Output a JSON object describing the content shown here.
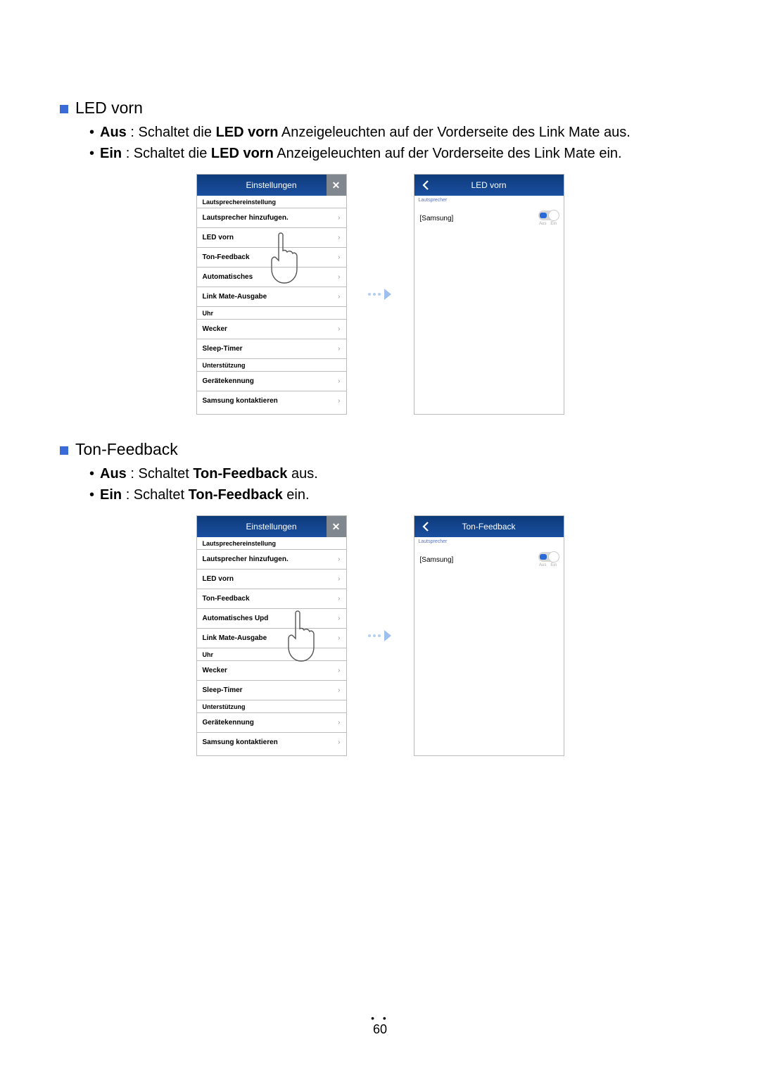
{
  "page_number": "60",
  "section1": {
    "title": "LED vorn",
    "bullets": [
      {
        "bold1": "Aus",
        "mid": " : Schaltet die ",
        "bold2": "LED vorn",
        "rest": " Anzeigeleuchten auf der Vorderseite des Link Mate aus."
      },
      {
        "bold1": "Ein",
        "mid": " : Schaltet die ",
        "bold2": "LED vorn",
        "rest": " Anzeigeleuchten auf der Vorderseite des Link Mate ein."
      }
    ],
    "left_phone": {
      "title": "Einstellungen",
      "groups": [
        {
          "label": "Lautsprechereinstellung",
          "items": [
            "Lautsprecher hinzufugen.",
            "LED vorn",
            "Ton-Feedback",
            "Automatisches",
            "Link Mate-Ausgabe"
          ]
        },
        {
          "label": "Uhr",
          "items": [
            "Wecker",
            "Sleep-Timer"
          ]
        },
        {
          "label": "Unterstützung",
          "items": [
            "Gerätekennung",
            "Samsung kontaktieren"
          ]
        }
      ]
    },
    "right_phone": {
      "title": "LED vorn",
      "section": "Lautsprecher",
      "row": "[Samsung]",
      "toggle": {
        "off": "Aus",
        "on": "Ein",
        "state": "on_right"
      }
    }
  },
  "section2": {
    "title": "Ton-Feedback",
    "bullets": [
      {
        "bold1": "Aus",
        "mid": " : Schaltet ",
        "bold2": "Ton-Feedback",
        "rest": " aus."
      },
      {
        "bold1": "Ein",
        "mid": " : Schaltet ",
        "bold2": "Ton-Feedback",
        "rest": " ein."
      }
    ],
    "left_phone": {
      "title": "Einstellungen",
      "groups": [
        {
          "label": "Lautsprechereinstellung",
          "items": [
            "Lautsprecher hinzufugen.",
            "LED vorn",
            "Ton-Feedback",
            "Automatisches Upd",
            "Link Mate-Ausgabe"
          ]
        },
        {
          "label": "Uhr",
          "items": [
            "Wecker",
            "Sleep-Timer"
          ]
        },
        {
          "label": "Unterstützung",
          "items": [
            "Gerätekennung",
            "Samsung kontaktieren"
          ]
        }
      ]
    },
    "right_phone": {
      "title": "Ton-Feedback",
      "section": "Lautsprecher",
      "row": "[Samsung]",
      "toggle": {
        "off": "Aus",
        "on": "Ein",
        "state": "on_right"
      }
    }
  }
}
